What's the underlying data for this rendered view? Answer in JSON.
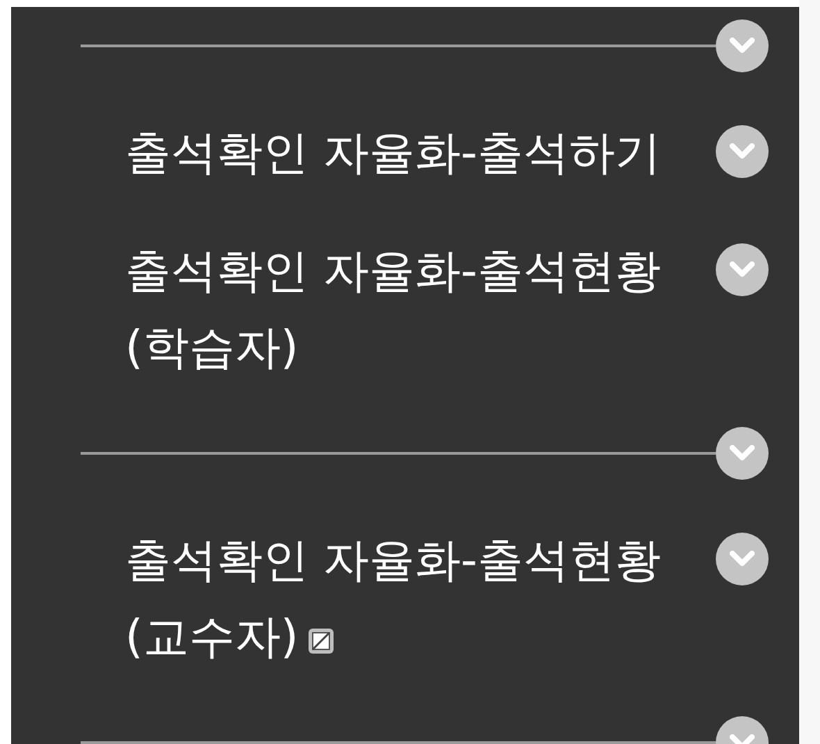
{
  "items": [
    {
      "kind": "divider"
    },
    {
      "kind": "activity",
      "lines": [
        "출석확인 자율화-출석하기"
      ],
      "restricted": false
    },
    {
      "kind": "activity",
      "lines": [
        "출석확인 자율화-출석현황",
        "(학습자)"
      ],
      "restricted": false
    },
    {
      "kind": "divider"
    },
    {
      "kind": "activity",
      "lines": [
        "출석확인 자율화-출석현황",
        "(교수자)"
      ],
      "restricted": true
    },
    {
      "kind": "divider"
    }
  ]
}
